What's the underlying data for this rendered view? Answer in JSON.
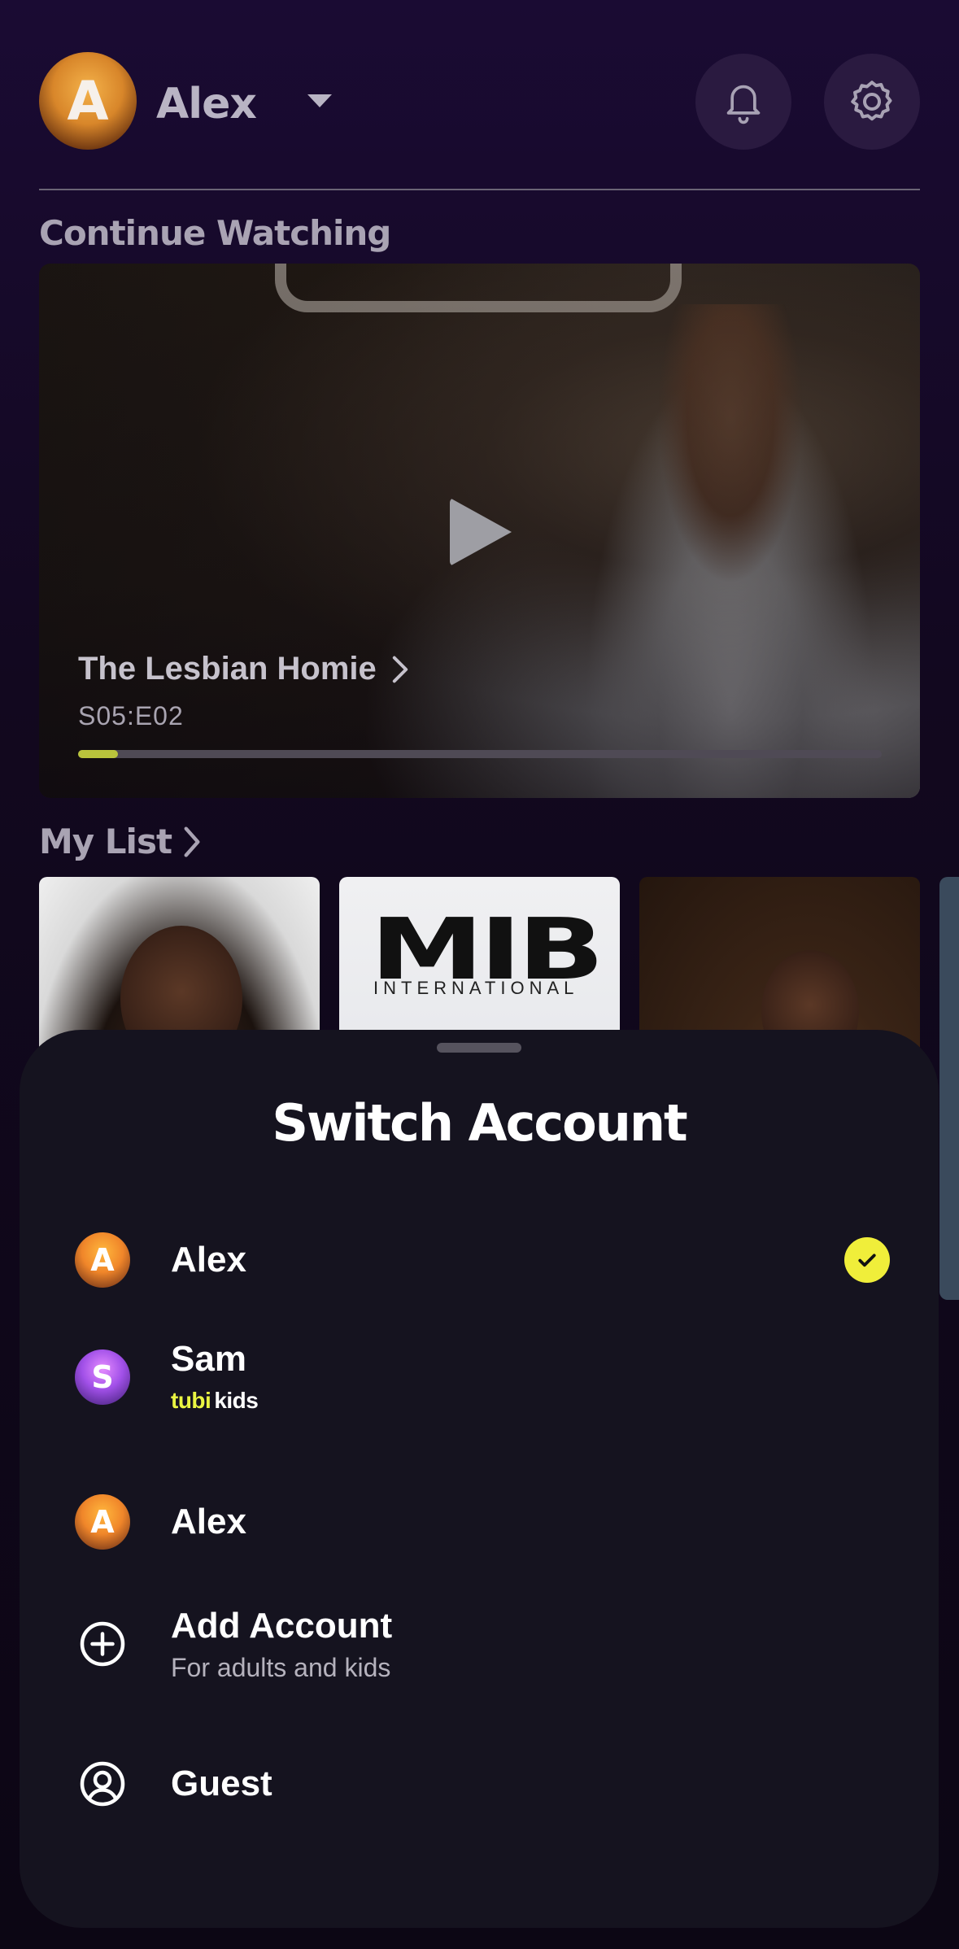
{
  "header": {
    "avatar_letter": "A",
    "profile_name": "Alex"
  },
  "continue_watching": {
    "title": "Continue Watching",
    "show_title": "The Lesbian Homie",
    "episode": "S05:E02",
    "progress": 0.05
  },
  "my_list": {
    "title": "My List",
    "posters": [
      {
        "name": "Poster 1"
      },
      {
        "name": "MIB International",
        "logo": "MIB",
        "subtitle": "INTERNATIONAL"
      },
      {
        "name": "Poster 3"
      }
    ]
  },
  "sheet": {
    "title": "Switch Account",
    "accounts": [
      {
        "letter": "A",
        "name": "Alex",
        "selected": true,
        "color": "#f0862a"
      },
      {
        "letter": "S",
        "name": "Sam",
        "badge_tubi": "tubi",
        "badge_kids": "kids",
        "color": "#a150e8"
      },
      {
        "letter": "A",
        "name": "Alex",
        "color": "#f0862a"
      }
    ],
    "add_account": {
      "label": "Add Account",
      "sub": "For adults and kids"
    },
    "guest": {
      "label": "Guest"
    }
  },
  "colors": {
    "accent_yellow": "#f0ee3a",
    "progress_fill": "#b9c43c",
    "sheet_bg": "#15131f"
  }
}
